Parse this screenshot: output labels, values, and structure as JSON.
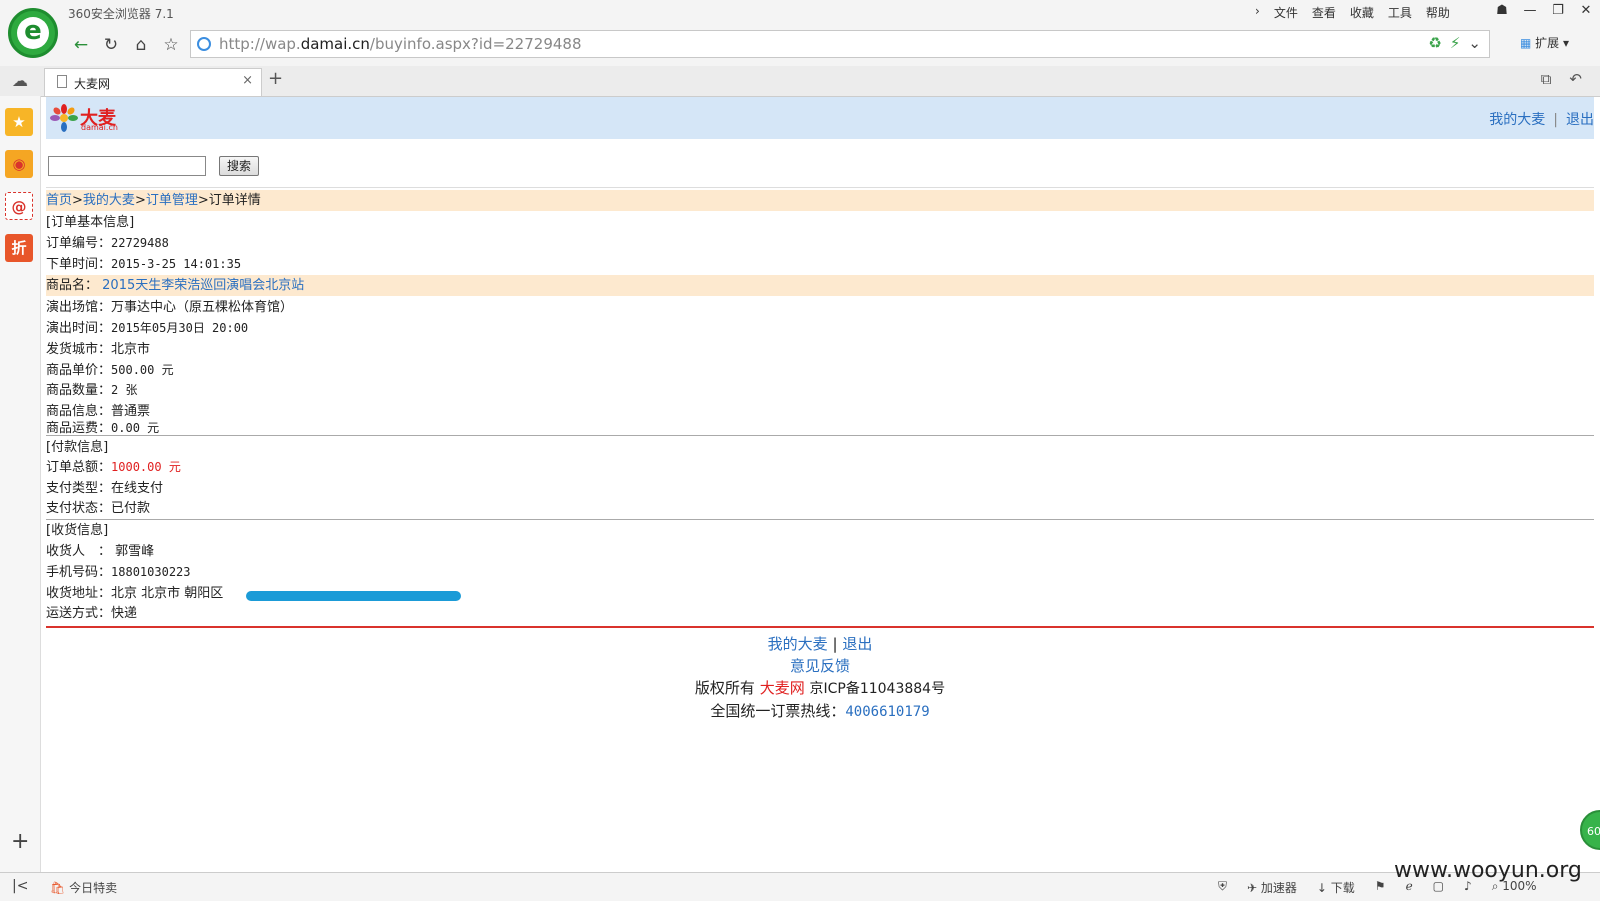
{
  "browser": {
    "app_title": "360安全浏览器 7.1",
    "menu": [
      "文件",
      "查看",
      "收藏",
      "工具",
      "帮助"
    ],
    "url_prefix": "http://wap.",
    "url_domain": "damai.cn",
    "url_path": "/buyinfo.aspx?id=22729488",
    "extensions_label": "扩展",
    "tab_title": "大麦网",
    "status_left": "今日特卖",
    "status_right": [
      "加速器",
      "下载",
      "100%"
    ],
    "watermark": "www.wooyun.org",
    "badge": "60"
  },
  "site": {
    "logo_text": "大麦",
    "logo_sub": "damai.cn",
    "header_links": {
      "my_damai": "我的大麦",
      "logout": "退出"
    },
    "search_button": "搜索"
  },
  "breadcrumb": {
    "home": "首页",
    "my_damai": "我的大麦",
    "order_mgmt": "订单管理",
    "current": "订单详情",
    "sep": ">"
  },
  "order": {
    "section_basic": "[订单基本信息]",
    "order_no_label": "订单编号：",
    "order_no": "22729488",
    "order_time_label": "下单时间：",
    "order_time": "2015-3-25 14:01:35",
    "product_name_label": "商品名：",
    "product_name": "2015天生李荣浩巡回演唱会北京站",
    "venue_label": "演出场馆：",
    "venue": "万事达中心（原五棵松体育馆）",
    "show_time_label": "演出时间：",
    "show_time": "2015年05月30日 20:00",
    "ship_city_label": "发货城市：",
    "ship_city": "北京市",
    "unit_price_label": "商品单价：",
    "unit_price": "500.00 元",
    "quantity_label": "商品数量：",
    "quantity": "2 张",
    "product_info_label": "商品信息：",
    "product_info": "普通票",
    "shipping_fee_label": "商品运费：",
    "shipping_fee": "0.00 元"
  },
  "payment": {
    "section": "[付款信息]",
    "total_label": "订单总额：",
    "total": "1000.00 元",
    "pay_type_label": "支付类型：",
    "pay_type": "在线支付",
    "pay_status_label": "支付状态：",
    "pay_status": "已付款"
  },
  "receiver": {
    "section": "[收货信息]",
    "name_label": "收货人　：",
    "name": "郭雪峰",
    "phone_label": "手机号码：",
    "phone": "18801030223",
    "address_label": "收货地址：",
    "address": "北京 北京市 朝阳区",
    "delivery_label": "运送方式：",
    "delivery": "快递"
  },
  "footer": {
    "my_damai": "我的大麦",
    "sep": "|",
    "logout": "退出",
    "feedback": "意见反馈",
    "copyright": "版权所有",
    "brand": "大麦网",
    "icp": "京ICP备11043884号",
    "hotline_label": "全国统一订票热线：",
    "hotline": "4006610179"
  },
  "colors": {
    "header_bg": "#d5e6f7",
    "highlight_bg": "#fde9cf",
    "link": "#2a6fc0",
    "accent_red": "#e02020"
  }
}
